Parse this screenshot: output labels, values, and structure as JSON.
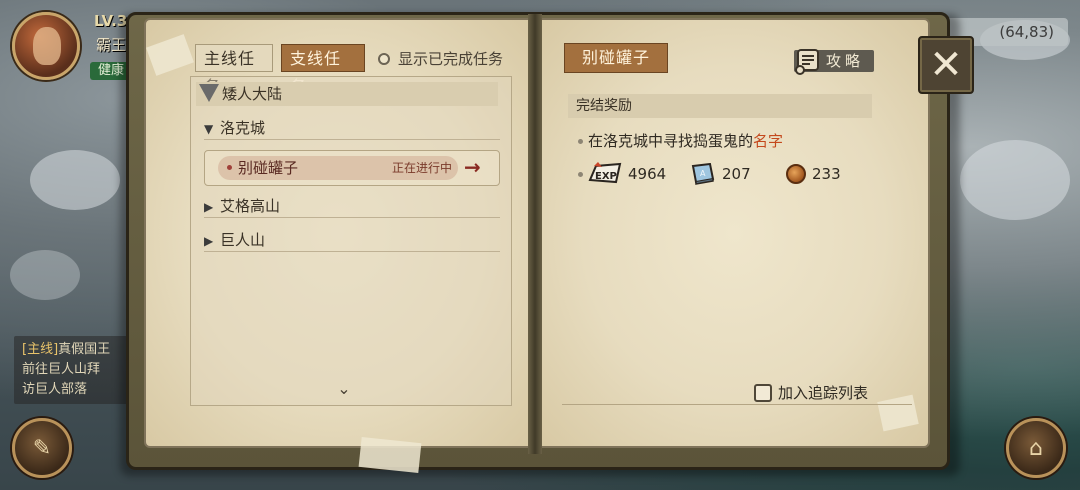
{
  "hud": {
    "level": "LV.3",
    "player_name": "霸王",
    "status": "健康",
    "coords": "(64,83)"
  },
  "side_tracker": {
    "tag": "[主线]",
    "title": "真假国王",
    "line1": "前往巨人山拜",
    "line2": "访巨人部落"
  },
  "left_page": {
    "tab_main": "主线任务",
    "tab_side": "支线任务",
    "show_completed": "显示已完成任务",
    "region": "矮人大陆",
    "cities": [
      {
        "name": "洛克城",
        "expanded": true
      },
      {
        "name": "艾格高山",
        "expanded": false
      },
      {
        "name": "巨人山",
        "expanded": false
      }
    ],
    "quest": {
      "name": "别碰罐子",
      "status": "正在进行中"
    },
    "more_icon": "chevron-down-icon"
  },
  "right_page": {
    "quest_title": "别碰罐子",
    "guide_label": "攻略",
    "reward_header": "完结奖励",
    "objective_prefix": "在洛克城中寻找捣蛋鬼的",
    "objective_highlight": "名字",
    "rewards": {
      "exp": "4964",
      "book": "207",
      "coin": "233"
    },
    "track_label": "加入追踪列表",
    "close_icon": "close-icon"
  },
  "colors": {
    "tab_active": "#a3703e",
    "highlight": "#c4481c",
    "page_bg": "#e7dcbf"
  }
}
